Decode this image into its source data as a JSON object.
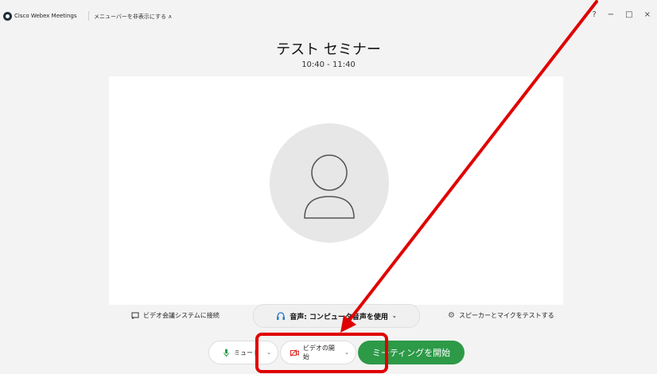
{
  "titlebar": {
    "app_name": "Cisco Webex Meetings",
    "menu_toggle": "メニューバーを非表示にする ∧",
    "help_icon": "?",
    "minimize_icon": "−",
    "maximize_icon": "□",
    "close_icon": "×"
  },
  "meeting": {
    "title": "テスト セミナー",
    "time": "10:40 - 11:40"
  },
  "options": {
    "video_system_label": "ビデオ会議システムに接続",
    "audio_label": "音声: コンピュータ音声を使用",
    "speaker_test_label": "スピーカーとマイクをテストする"
  },
  "controls": {
    "mute_label": "ミュート",
    "video_label": "ビデオの開始",
    "start_label": "ミーティングを開始"
  },
  "colors": {
    "start_button": "#2c9a47",
    "annotation": "#e00000"
  },
  "icons": {
    "app_logo": "webex-logo-icon",
    "avatar": "user-avatar-icon",
    "video_system": "cast-icon",
    "audio": "headset-icon",
    "settings": "gear-icon",
    "mic": "microphone-icon",
    "video": "video-off-icon"
  }
}
